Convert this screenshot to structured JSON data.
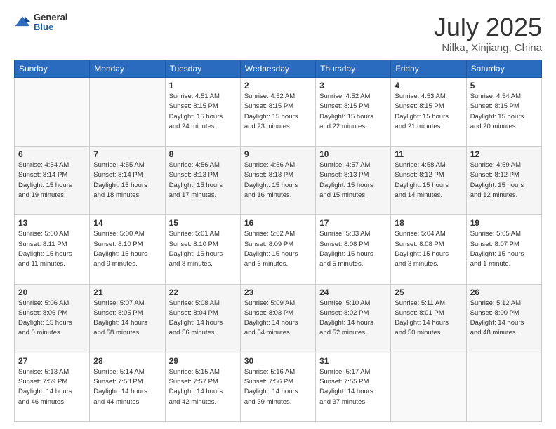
{
  "header": {
    "logo_general": "General",
    "logo_blue": "Blue",
    "month_title": "July 2025",
    "location": "Nilka, Xinjiang, China"
  },
  "weekdays": [
    "Sunday",
    "Monday",
    "Tuesday",
    "Wednesday",
    "Thursday",
    "Friday",
    "Saturday"
  ],
  "weeks": [
    [
      {
        "day": "",
        "info": ""
      },
      {
        "day": "",
        "info": ""
      },
      {
        "day": "1",
        "info": "Sunrise: 4:51 AM\nSunset: 8:15 PM\nDaylight: 15 hours\nand 24 minutes."
      },
      {
        "day": "2",
        "info": "Sunrise: 4:52 AM\nSunset: 8:15 PM\nDaylight: 15 hours\nand 23 minutes."
      },
      {
        "day": "3",
        "info": "Sunrise: 4:52 AM\nSunset: 8:15 PM\nDaylight: 15 hours\nand 22 minutes."
      },
      {
        "day": "4",
        "info": "Sunrise: 4:53 AM\nSunset: 8:15 PM\nDaylight: 15 hours\nand 21 minutes."
      },
      {
        "day": "5",
        "info": "Sunrise: 4:54 AM\nSunset: 8:15 PM\nDaylight: 15 hours\nand 20 minutes."
      }
    ],
    [
      {
        "day": "6",
        "info": "Sunrise: 4:54 AM\nSunset: 8:14 PM\nDaylight: 15 hours\nand 19 minutes."
      },
      {
        "day": "7",
        "info": "Sunrise: 4:55 AM\nSunset: 8:14 PM\nDaylight: 15 hours\nand 18 minutes."
      },
      {
        "day": "8",
        "info": "Sunrise: 4:56 AM\nSunset: 8:13 PM\nDaylight: 15 hours\nand 17 minutes."
      },
      {
        "day": "9",
        "info": "Sunrise: 4:56 AM\nSunset: 8:13 PM\nDaylight: 15 hours\nand 16 minutes."
      },
      {
        "day": "10",
        "info": "Sunrise: 4:57 AM\nSunset: 8:13 PM\nDaylight: 15 hours\nand 15 minutes."
      },
      {
        "day": "11",
        "info": "Sunrise: 4:58 AM\nSunset: 8:12 PM\nDaylight: 15 hours\nand 14 minutes."
      },
      {
        "day": "12",
        "info": "Sunrise: 4:59 AM\nSunset: 8:12 PM\nDaylight: 15 hours\nand 12 minutes."
      }
    ],
    [
      {
        "day": "13",
        "info": "Sunrise: 5:00 AM\nSunset: 8:11 PM\nDaylight: 15 hours\nand 11 minutes."
      },
      {
        "day": "14",
        "info": "Sunrise: 5:00 AM\nSunset: 8:10 PM\nDaylight: 15 hours\nand 9 minutes."
      },
      {
        "day": "15",
        "info": "Sunrise: 5:01 AM\nSunset: 8:10 PM\nDaylight: 15 hours\nand 8 minutes."
      },
      {
        "day": "16",
        "info": "Sunrise: 5:02 AM\nSunset: 8:09 PM\nDaylight: 15 hours\nand 6 minutes."
      },
      {
        "day": "17",
        "info": "Sunrise: 5:03 AM\nSunset: 8:08 PM\nDaylight: 15 hours\nand 5 minutes."
      },
      {
        "day": "18",
        "info": "Sunrise: 5:04 AM\nSunset: 8:08 PM\nDaylight: 15 hours\nand 3 minutes."
      },
      {
        "day": "19",
        "info": "Sunrise: 5:05 AM\nSunset: 8:07 PM\nDaylight: 15 hours\nand 1 minute."
      }
    ],
    [
      {
        "day": "20",
        "info": "Sunrise: 5:06 AM\nSunset: 8:06 PM\nDaylight: 15 hours\nand 0 minutes."
      },
      {
        "day": "21",
        "info": "Sunrise: 5:07 AM\nSunset: 8:05 PM\nDaylight: 14 hours\nand 58 minutes."
      },
      {
        "day": "22",
        "info": "Sunrise: 5:08 AM\nSunset: 8:04 PM\nDaylight: 14 hours\nand 56 minutes."
      },
      {
        "day": "23",
        "info": "Sunrise: 5:09 AM\nSunset: 8:03 PM\nDaylight: 14 hours\nand 54 minutes."
      },
      {
        "day": "24",
        "info": "Sunrise: 5:10 AM\nSunset: 8:02 PM\nDaylight: 14 hours\nand 52 minutes."
      },
      {
        "day": "25",
        "info": "Sunrise: 5:11 AM\nSunset: 8:01 PM\nDaylight: 14 hours\nand 50 minutes."
      },
      {
        "day": "26",
        "info": "Sunrise: 5:12 AM\nSunset: 8:00 PM\nDaylight: 14 hours\nand 48 minutes."
      }
    ],
    [
      {
        "day": "27",
        "info": "Sunrise: 5:13 AM\nSunset: 7:59 PM\nDaylight: 14 hours\nand 46 minutes."
      },
      {
        "day": "28",
        "info": "Sunrise: 5:14 AM\nSunset: 7:58 PM\nDaylight: 14 hours\nand 44 minutes."
      },
      {
        "day": "29",
        "info": "Sunrise: 5:15 AM\nSunset: 7:57 PM\nDaylight: 14 hours\nand 42 minutes."
      },
      {
        "day": "30",
        "info": "Sunrise: 5:16 AM\nSunset: 7:56 PM\nDaylight: 14 hours\nand 39 minutes."
      },
      {
        "day": "31",
        "info": "Sunrise: 5:17 AM\nSunset: 7:55 PM\nDaylight: 14 hours\nand 37 minutes."
      },
      {
        "day": "",
        "info": ""
      },
      {
        "day": "",
        "info": ""
      }
    ]
  ]
}
